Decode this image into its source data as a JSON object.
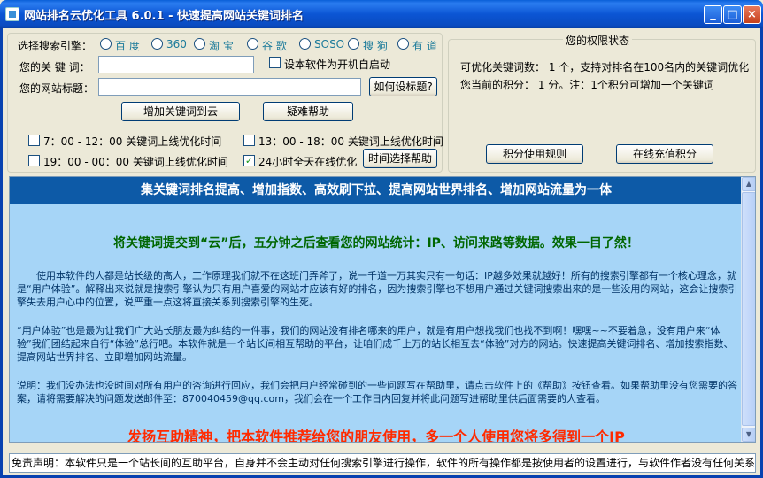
{
  "window": {
    "title": "网站排名云优化工具 6.0.1 - 快速提高网站关键词排名"
  },
  "search_engines": {
    "label": "选择搜索引擎：",
    "options": [
      "百 度",
      "360",
      "淘 宝",
      "谷 歌",
      "SOSO",
      "搜 狗",
      "有 道"
    ]
  },
  "keyword": {
    "label": "您的关 键 词：",
    "value": ""
  },
  "autostart": {
    "label": "设本软件为开机自启动",
    "checked": false
  },
  "site_title": {
    "label": "您的网站标题：",
    "value": "",
    "help_button": "如何设标题?"
  },
  "actions": {
    "add_button": "增加关键词到云",
    "faq_button": "疑难帮助"
  },
  "schedule": {
    "slot1": {
      "label": "7：00 - 12：00 关键词上线优化时间",
      "checked": false
    },
    "slot2": {
      "label": "13：00 - 18：00 关键词上线优化时间",
      "checked": false
    },
    "slot3": {
      "label": "19：00 - 00：00 关键词上线优化时间",
      "checked": false
    },
    "slot4": {
      "label": "24小时全天在线优化",
      "checked": true
    },
    "help_button": "时间选择帮助"
  },
  "permissions": {
    "title": "您的权限状态",
    "line1": "可优化关键词数： 1 个，支持对排名在100名内的关键词优化",
    "line2": "您当前的积分： 1 分。注：1个积分可增加一个关键词",
    "rules_button": "积分使用规则",
    "recharge_button": "在线充值积分"
  },
  "content": {
    "banner": "集关键词排名提高、增加指数、高效刷下拉、提高网站世界排名、增加网站流量为一体",
    "headline": "将关键词提交到“云”后，五分钟之后查看您的网站统计：IP、访问来路等数据。效果一目了然！",
    "para1": "使用本软件的人都是站长级的高人，工作原理我们就不在这班门弄斧了，说一千道一万其实只有一句话：IP越多效果就越好！所有的搜索引擎都有一个核心理念，就是“用户体验”。解释出来说就是搜索引擎认为只有用户喜爱的网站才应该有好的排名，因为搜索引擎也不想用户通过关键词搜索出来的是一些没用的网站，这会让搜索引擎失去用户心中的位置，说严重一点这将直接关系到搜索引擎的生死。",
    "para2": "“用户体验”也是最为让我们广大站长朋友最为纠结的一件事，我们的网站没有排名哪来的用户，就是有用户想找我们也找不到啊！嘿嘿~~不要着急，没有用户来“体验”我们团结起来自行“体验”总行吧。本软件就是一个站长间相互帮助的平台，让咱们成千上万的站长相互去“体验”对方的网站。快速提高关键词排名、增加搜索指数、提高网站世界排名、立即增加网站流量。",
    "para3": "说明：我们没办法也没时间对所有用户的咨询进行回应，我们会把用户经常碰到的一些问题写在帮助里，请点击软件上的《帮助》按钮查看。如果帮助里没有您需要的答案，请将需要解决的问题发送邮件至：870040459@qq.com，我们会在一个工作日内回复并将此问题写进帮助里供后面需要的人查看。",
    "promo": "发扬互助精神，把本软件推荐给您的朋友使用，多一个人使用您将多得到一个IP"
  },
  "footer": {
    "disclaimer": "免责声明：本软件只是一个站长间的互助平台，自身并不会主动对任何搜索引擎进行操作，软件的所有操作都是按使用者的设置进行，与软件作者没有任何关系。"
  }
}
